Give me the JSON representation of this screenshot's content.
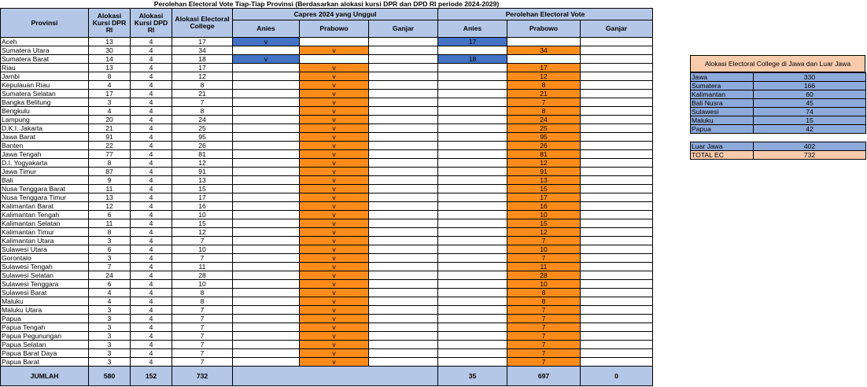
{
  "title": "Perolehan Electoral Vote Tiap-Tiap Provinsi (Berdasarkan alokasi kursi DPR dan DPD RI periode 2024-2029)",
  "headers": {
    "provinsi": "Provinsi",
    "dpr": "Alokasi Kursi DPR RI",
    "dpd": "Alokasi Kursi DPD RI",
    "ec": "Alokasi Electoral College",
    "capres_group": "Capres 2024 yang Unggul",
    "ev_group": "Perolehan Electoral Vote",
    "anies": "Anies",
    "prabowo": "Prabowo",
    "ganjar": "Ganjar"
  },
  "rows": [
    {
      "name": "Aceh",
      "dpr": "13",
      "dpd": "4",
      "ec": "17",
      "winner": "anies",
      "mark": "v",
      "ev_anies": "17",
      "ev_prabowo": ""
    },
    {
      "name": "Sumatera Utara",
      "dpr": "30",
      "dpd": "4",
      "ec": "34",
      "winner": "prabowo",
      "mark": "v",
      "ev_anies": "",
      "ev_prabowo": "34"
    },
    {
      "name": "Sumatera Barat",
      "dpr": "14",
      "dpd": "4",
      "ec": "18",
      "winner": "anies",
      "mark": "v",
      "ev_anies": "18",
      "ev_prabowo": ""
    },
    {
      "name": "Riau",
      "dpr": "13",
      "dpd": "4",
      "ec": "17",
      "winner": "prabowo",
      "mark": "v",
      "ev_anies": "",
      "ev_prabowo": "17"
    },
    {
      "name": "Jambi",
      "dpr": "8",
      "dpd": "4",
      "ec": "12",
      "winner": "prabowo",
      "mark": "v",
      "ev_anies": "",
      "ev_prabowo": "12"
    },
    {
      "name": "Kepulauan Riau",
      "dpr": "4",
      "dpd": "4",
      "ec": "8",
      "winner": "prabowo",
      "mark": "v",
      "ev_anies": "",
      "ev_prabowo": "8"
    },
    {
      "name": "Sumatera Selatan",
      "dpr": "17",
      "dpd": "4",
      "ec": "21",
      "winner": "prabowo",
      "mark": "v",
      "ev_anies": "",
      "ev_prabowo": "21"
    },
    {
      "name": "Bangka Belitung",
      "dpr": "3",
      "dpd": "4",
      "ec": "7",
      "winner": "prabowo",
      "mark": "v",
      "ev_anies": "",
      "ev_prabowo": "7"
    },
    {
      "name": "Bengkulu",
      "dpr": "4",
      "dpd": "4",
      "ec": "8",
      "winner": "prabowo",
      "mark": "v",
      "ev_anies": "",
      "ev_prabowo": "8"
    },
    {
      "name": "Lampung",
      "dpr": "20",
      "dpd": "4",
      "ec": "24",
      "winner": "prabowo",
      "mark": "v",
      "ev_anies": "",
      "ev_prabowo": "24"
    },
    {
      "name": "D.K.I. Jakarta",
      "dpr": "21",
      "dpd": "4",
      "ec": "25",
      "winner": "prabowo",
      "mark": "v",
      "ev_anies": "",
      "ev_prabowo": "25"
    },
    {
      "name": "Jawa Barat",
      "dpr": "91",
      "dpd": "4",
      "ec": "95",
      "winner": "prabowo",
      "mark": "v",
      "ev_anies": "",
      "ev_prabowo": "95"
    },
    {
      "name": "Banten",
      "dpr": "22",
      "dpd": "4",
      "ec": "26",
      "winner": "prabowo",
      "mark": "v",
      "ev_anies": "",
      "ev_prabowo": "26"
    },
    {
      "name": "Jawa Tengah",
      "dpr": "77",
      "dpd": "4",
      "ec": "81",
      "winner": "prabowo",
      "mark": "v",
      "ev_anies": "",
      "ev_prabowo": "81"
    },
    {
      "name": "D.I. Yogyakarta",
      "dpr": "8",
      "dpd": "4",
      "ec": "12",
      "winner": "prabowo",
      "mark": "v",
      "ev_anies": "",
      "ev_prabowo": "12"
    },
    {
      "name": "Jawa Timur",
      "dpr": "87",
      "dpd": "4",
      "ec": "91",
      "winner": "prabowo",
      "mark": "v",
      "ev_anies": "",
      "ev_prabowo": "91"
    },
    {
      "name": "Bali",
      "dpr": "9",
      "dpd": "4",
      "ec": "13",
      "winner": "prabowo",
      "mark": "v",
      "ev_anies": "",
      "ev_prabowo": "13"
    },
    {
      "name": "Nusa Tenggara Barat",
      "dpr": "11",
      "dpd": "4",
      "ec": "15",
      "winner": "prabowo",
      "mark": "v",
      "ev_anies": "",
      "ev_prabowo": "15"
    },
    {
      "name": "Nusa Tenggara Timur",
      "dpr": "13",
      "dpd": "4",
      "ec": "17",
      "winner": "prabowo",
      "mark": "v",
      "ev_anies": "",
      "ev_prabowo": "17"
    },
    {
      "name": "Kalimantan Barat",
      "dpr": "12",
      "dpd": "4",
      "ec": "16",
      "winner": "prabowo",
      "mark": "v",
      "ev_anies": "",
      "ev_prabowo": "16"
    },
    {
      "name": "Kalimantan Tengah",
      "dpr": "6",
      "dpd": "4",
      "ec": "10",
      "winner": "prabowo",
      "mark": "v",
      "ev_anies": "",
      "ev_prabowo": "10"
    },
    {
      "name": "Kalimantan Selatan",
      "dpr": "11",
      "dpd": "4",
      "ec": "15",
      "winner": "prabowo",
      "mark": "v",
      "ev_anies": "",
      "ev_prabowo": "15"
    },
    {
      "name": "Kalimantan Timur",
      "dpr": "8",
      "dpd": "4",
      "ec": "12",
      "winner": "prabowo",
      "mark": "v",
      "ev_anies": "",
      "ev_prabowo": "12"
    },
    {
      "name": "Kalimantan Utara",
      "dpr": "3",
      "dpd": "4",
      "ec": "7",
      "winner": "prabowo",
      "mark": "v",
      "ev_anies": "",
      "ev_prabowo": "7"
    },
    {
      "name": "Sulawesi Utara",
      "dpr": "6",
      "dpd": "4",
      "ec": "10",
      "winner": "prabowo",
      "mark": "v",
      "ev_anies": "",
      "ev_prabowo": "10"
    },
    {
      "name": "Gorontalo",
      "dpr": "3",
      "dpd": "4",
      "ec": "7",
      "winner": "prabowo",
      "mark": "v",
      "ev_anies": "",
      "ev_prabowo": "7"
    },
    {
      "name": "Sulawesi Tengah",
      "dpr": "7",
      "dpd": "4",
      "ec": "11",
      "winner": "prabowo",
      "mark": "v",
      "ev_anies": "",
      "ev_prabowo": "11"
    },
    {
      "name": "Sulawesi Selatan",
      "dpr": "24",
      "dpd": "4",
      "ec": "28",
      "winner": "prabowo",
      "mark": "v",
      "ev_anies": "",
      "ev_prabowo": "28"
    },
    {
      "name": "Sulawesi Tenggara",
      "dpr": "6",
      "dpd": "4",
      "ec": "10",
      "winner": "prabowo",
      "mark": "v",
      "ev_anies": "",
      "ev_prabowo": "10"
    },
    {
      "name": "Sulawesi Barat",
      "dpr": "4",
      "dpd": "4",
      "ec": "8",
      "winner": "prabowo",
      "mark": "v",
      "ev_anies": "",
      "ev_prabowo": "8"
    },
    {
      "name": "Maluku",
      "dpr": "4",
      "dpd": "4",
      "ec": "8",
      "winner": "prabowo",
      "mark": "v",
      "ev_anies": "",
      "ev_prabowo": "8"
    },
    {
      "name": "Maluku Utara",
      "dpr": "3",
      "dpd": "4",
      "ec": "7",
      "winner": "prabowo",
      "mark": "v",
      "ev_anies": "",
      "ev_prabowo": "7"
    },
    {
      "name": "Papua",
      "dpr": "3",
      "dpd": "4",
      "ec": "7",
      "winner": "prabowo",
      "mark": "v",
      "ev_anies": "",
      "ev_prabowo": "7"
    },
    {
      "name": "Papua Tengah",
      "dpr": "3",
      "dpd": "4",
      "ec": "7",
      "winner": "prabowo",
      "mark": "v",
      "ev_anies": "",
      "ev_prabowo": "7"
    },
    {
      "name": "Papua Pegunungan",
      "dpr": "3",
      "dpd": "4",
      "ec": "7",
      "winner": "prabowo",
      "mark": "v",
      "ev_anies": "",
      "ev_prabowo": "7"
    },
    {
      "name": "Papua Selatan",
      "dpr": "3",
      "dpd": "4",
      "ec": "7",
      "winner": "prabowo",
      "mark": "v",
      "ev_anies": "",
      "ev_prabowo": "7"
    },
    {
      "name": "Papua Barat Daya",
      "dpr": "3",
      "dpd": "4",
      "ec": "7",
      "winner": "prabowo",
      "mark": "v",
      "ev_anies": "",
      "ev_prabowo": "7"
    },
    {
      "name": "Papua Barat",
      "dpr": "3",
      "dpd": "4",
      "ec": "7",
      "winner": "prabowo",
      "mark": "v",
      "ev_anies": "",
      "ev_prabowo": "7"
    }
  ],
  "total": {
    "label": "JUMLAH",
    "dpr": "580",
    "dpd": "152",
    "ec": "732",
    "ev_anies": "35",
    "ev_prabowo": "697",
    "ev_ganjar": "0"
  },
  "side": {
    "title": "Alokasi Electoral College di Jawa dan Luar Jawa",
    "regions": [
      {
        "label": "Jawa",
        "value": "330"
      },
      {
        "label": "Sumatera",
        "value": "166"
      },
      {
        "label": "Kalimantan",
        "value": "60"
      },
      {
        "label": "Bali Nusra",
        "value": "45"
      },
      {
        "label": "Sulawesi",
        "value": "74"
      },
      {
        "label": "Maluku",
        "value": "15"
      },
      {
        "label": "Papua",
        "value": "42"
      }
    ],
    "luar_jawa": {
      "label": "Luar Jawa",
      "value": "402"
    },
    "total_ec": {
      "label": "TOTAL EC",
      "value": "732"
    }
  },
  "colors": {
    "header": "#b4c7e7",
    "anies": "#4472c4",
    "prabowo": "#ff8c1a",
    "side_region": "#8eaadb",
    "side_title": "#f8cbad"
  }
}
